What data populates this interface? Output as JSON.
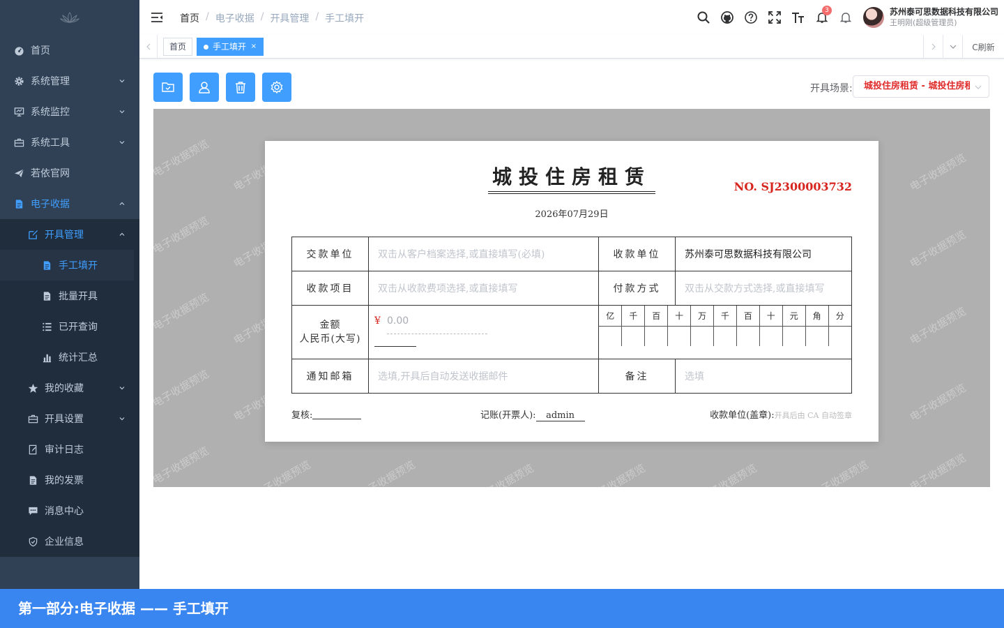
{
  "sidebar": {
    "items": [
      {
        "label": "首页"
      },
      {
        "label": "系统管理"
      },
      {
        "label": "系统监控"
      },
      {
        "label": "系统工具"
      },
      {
        "label": "若依官网"
      },
      {
        "label": "电子收据"
      },
      {
        "label": "开具管理"
      },
      {
        "label": "手工填开"
      },
      {
        "label": "批量开具"
      },
      {
        "label": "已开查询"
      },
      {
        "label": "统计汇总"
      },
      {
        "label": "我的收藏"
      },
      {
        "label": "开具设置"
      },
      {
        "label": "审计日志"
      },
      {
        "label": "我的发票"
      },
      {
        "label": "消息中心"
      },
      {
        "label": "企业信息"
      }
    ]
  },
  "navbar": {
    "breadcrumb": [
      "首页",
      "电子收据",
      "开具管理",
      "手工填开"
    ],
    "breadcrumb_sep": "/",
    "notification_count": "3",
    "user_company": "苏州泰可思数据科技有限公司",
    "user_role": "王明刚(超级管理员)"
  },
  "tags": {
    "home": "首页",
    "current": "手工填开",
    "close": "×",
    "refresh": "C刷新"
  },
  "toolbar": {
    "scene_label": "开具场景:",
    "scene_value": "城投住房租赁 - 城投住房租赁"
  },
  "receipt": {
    "title": "城投住房租赁",
    "number": "NO. SJ2300003732",
    "date": "2026年07月29日",
    "payer_label": "交款单位",
    "payer_placeholder": "双击从客户档案选择,或直接填写(必填)",
    "payee_label": "收款单位",
    "payee_value": "苏州泰可思数据科技有限公司",
    "item_label": "收款项目",
    "item_placeholder": "双击从收款费项选择,或直接填写",
    "paymethod_label": "付款方式",
    "paymethod_placeholder": "双击从交款方式选择,或直接填写",
    "amount_label_1": "金额",
    "amount_label_2": "人民币(大写)",
    "currency_symbol": "¥",
    "amount_value": "0.00",
    "digit_units": [
      "亿",
      "千",
      "百",
      "十",
      "万",
      "千",
      "百",
      "十",
      "元",
      "角",
      "分"
    ],
    "email_label": "通知邮箱",
    "email_placeholder": "选填,开具后自动发送收据邮件",
    "remark_label": "备注",
    "remark_placeholder": "选填",
    "review_label": "复核:",
    "bookkeeper_label": "记账(开票人):",
    "bookkeeper_value": "admin",
    "seal_label": "收款单位(盖章):",
    "seal_hint": "开具后由 CA 自动签章"
  },
  "watermark": "电子收据预览",
  "banner": "第一部分:电子收据 —— 手工填开",
  "colors": {
    "sidebar_bg": "#304156",
    "primary": "#409eff",
    "receipt_red": "#d7261f",
    "banner": "#3a86f0"
  }
}
